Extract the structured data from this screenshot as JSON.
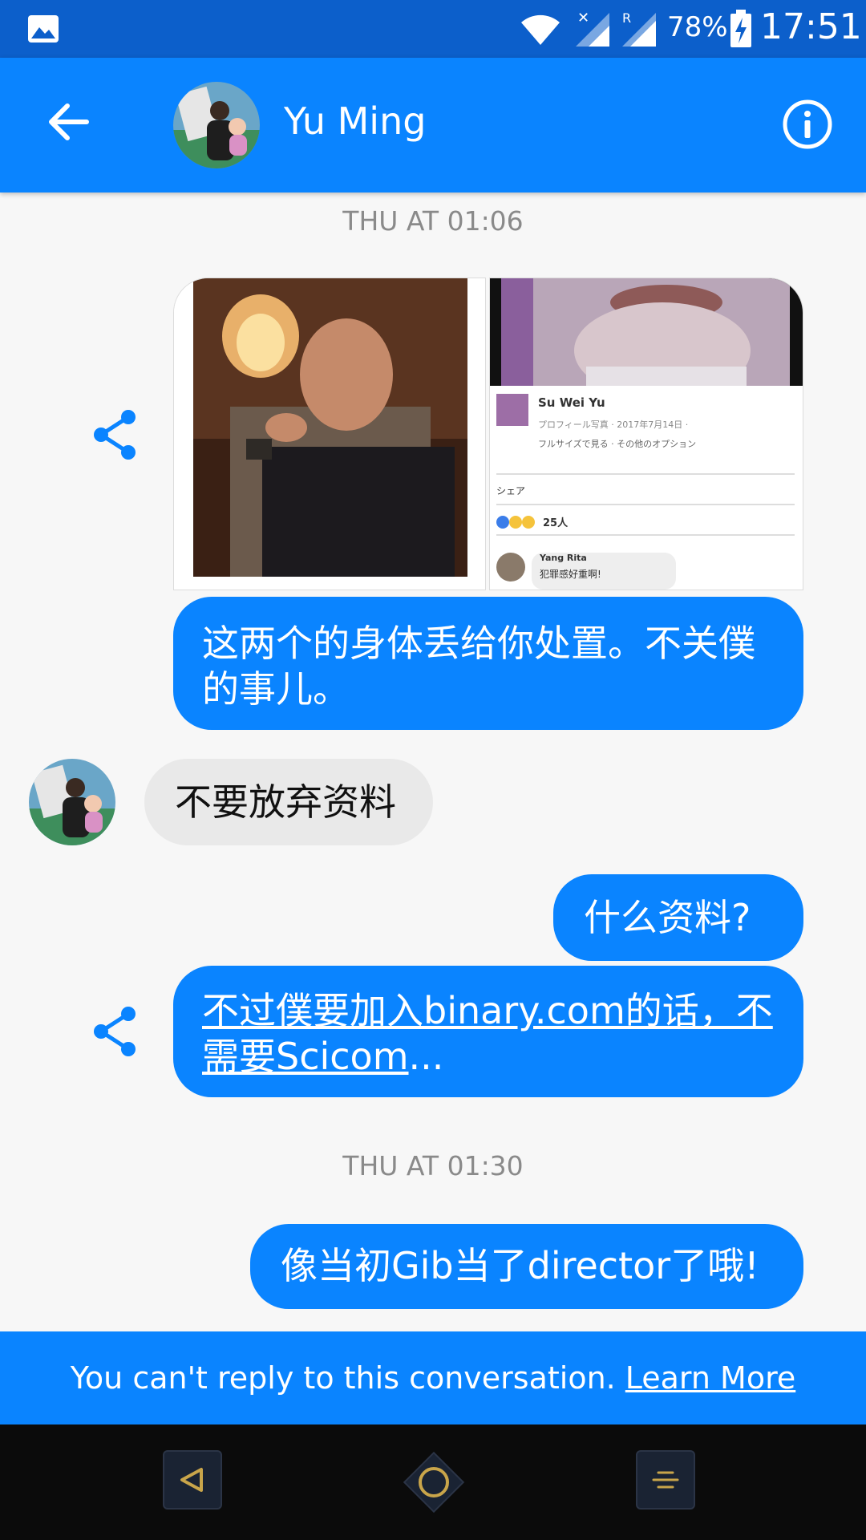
{
  "status_bar": {
    "battery_percent": "78%",
    "time": "17:51",
    "roaming_indicator": "R",
    "icons": [
      "gallery-icon",
      "wifi-icon",
      "signal-x-icon",
      "signal-roaming-icon",
      "battery-charging-icon"
    ]
  },
  "header": {
    "contact_name": "Yu Ming",
    "icons": [
      "back-arrow-icon",
      "info-icon"
    ]
  },
  "conversation": {
    "timestamp_1": "THU AT 01:06",
    "image_tile_2": {
      "name": "Su Wei Yu",
      "meta_line": "プロフィール写真 · 2017年7月14日 · ",
      "options_line": "フルサイズで見る · その他のオプション",
      "share_label": "シェア",
      "reaction_count": "25人",
      "commenter": "Yang Rita",
      "comment": "犯罪感好重啊!"
    },
    "msg_1": "这两个的身体丢给你处置。不关僕的事儿。",
    "msg_2": "不要放弃资料",
    "msg_3": "什么资料?",
    "msg_4_link_line1": "不过僕要加入binary.com的话，不",
    "msg_4_link_line2": "需要Scicom",
    "msg_4_ellipsis": "...",
    "timestamp_2": "THU AT 01:30",
    "msg_5": "像当初Gib当了director了哦!"
  },
  "banner": {
    "text": "You can't reply to this conversation.",
    "link": "Learn More"
  },
  "colors": {
    "status_bar": "#0c5fcb",
    "accent": "#0a84ff",
    "incoming_bubble": "#e9e9e9",
    "background": "#f7f7f7"
  }
}
